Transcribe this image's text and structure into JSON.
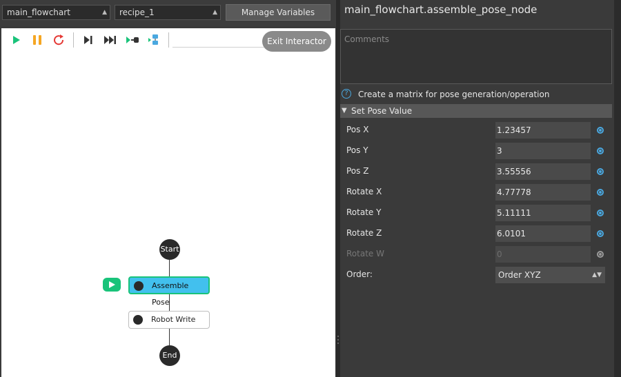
{
  "topbar": {
    "flowchart_select": "main_flowchart",
    "recipe_select": "recipe_1",
    "manage_variables_label": "Manage Variables"
  },
  "toolbar": {
    "icons": [
      "play-icon",
      "pause-icon",
      "restart-icon",
      "step-icon",
      "fast-forward-icon",
      "run-to-node-icon",
      "debug-node-icon"
    ],
    "exit_interactor_label": "Exit Interactor"
  },
  "flowchart": {
    "start_label": "Start",
    "assemble_pose_label": "Assemble Pose",
    "robot_write_label": "Robot Write",
    "end_label": "End"
  },
  "panel": {
    "title": "main_flowchart.assemble_pose_node",
    "comments_placeholder": "Comments",
    "description": "Create a matrix for pose generation/operation",
    "section_title": "Set Pose Value",
    "params": [
      {
        "label": "Pos X",
        "value": "1.23457",
        "enabled": true
      },
      {
        "label": "Pos Y",
        "value": "3",
        "enabled": true
      },
      {
        "label": "Pos Z",
        "value": "3.55556",
        "enabled": true
      },
      {
        "label": "Rotate X",
        "value": "4.77778",
        "enabled": true
      },
      {
        "label": "Rotate Y",
        "value": "5.11111",
        "enabled": true
      },
      {
        "label": "Rotate Z",
        "value": "6.0101",
        "enabled": true
      },
      {
        "label": "Rotate W",
        "value": "0",
        "enabled": false
      }
    ],
    "order_label": "Order:",
    "order_value": "Order XYZ"
  },
  "colors": {
    "accent": "#4aa8e0",
    "active_node": "#42c0ee",
    "run_green": "#19c37a"
  }
}
